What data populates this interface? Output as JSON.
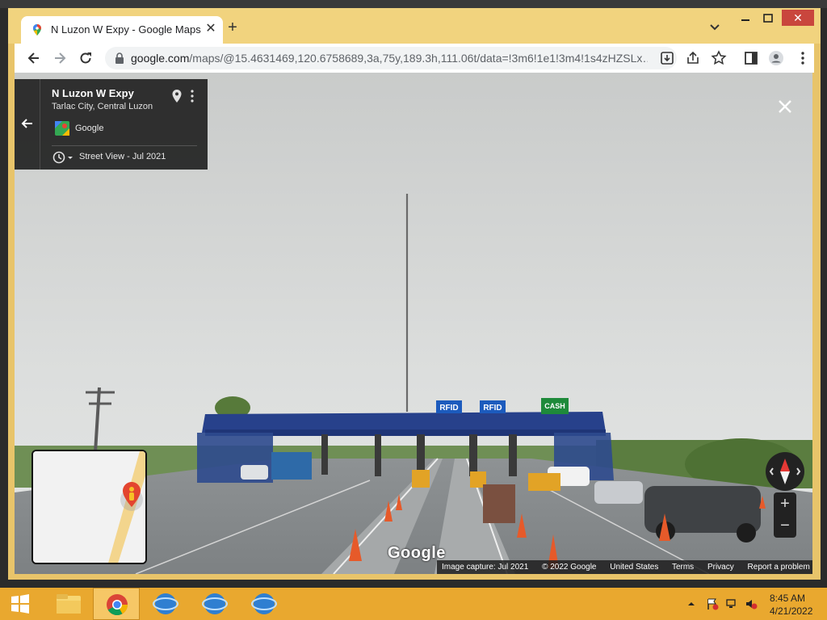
{
  "browser": {
    "tab_title": "N Luzon W Expy - Google Maps",
    "url_host": "google.com",
    "url_path": "/maps/@15.4631469,120.6758689,3a,75y,189.3h,111.06t/data=!3m6!1e1!3m4!1s4zHZSLx…"
  },
  "street_view": {
    "place_name": "N Luzon W Expy",
    "place_subtitle": "Tarlac City, Central Luzon",
    "provider": "Google",
    "timeline_label": "Street View - Jul 2021",
    "watermark": "Google",
    "scene_signs": {
      "rfid_left": "RFID",
      "rfid_right": "RFID",
      "cash": "CASH"
    }
  },
  "attribution": {
    "capture": "Image capture: Jul 2021",
    "copyright": "© 2022 Google",
    "region": "United States",
    "terms": "Terms",
    "privacy": "Privacy",
    "report": "Report a problem"
  },
  "taskbar": {
    "time": "8:45 AM",
    "date": "4/21/2022"
  },
  "icons": {
    "favicon": "google-maps-pin-icon",
    "controls": [
      "back-icon",
      "forward-icon",
      "reload-icon",
      "lock-icon",
      "install-icon",
      "share-icon",
      "star-icon",
      "side-panel-icon",
      "profile-icon",
      "menu-icon"
    ]
  },
  "colors": {
    "window_frame": "#e8c46a",
    "tab_strip": "#f1d37e",
    "taskbar": "#e9a82f",
    "close_button": "#c9463d"
  }
}
